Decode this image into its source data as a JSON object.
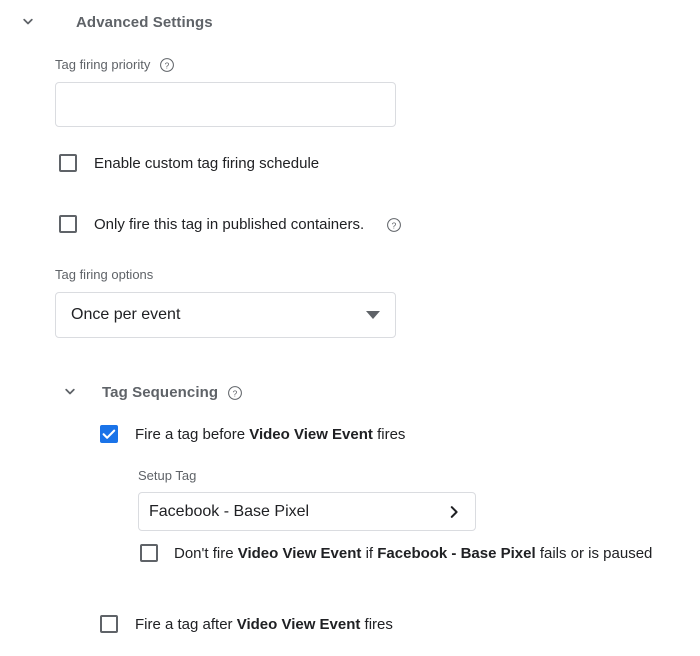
{
  "colors": {
    "accent": "#1a73e8",
    "label_gray": "#5f6368",
    "text_dark": "#202124",
    "border": "#dadce0",
    "background": "#ffffff"
  },
  "advanced_settings": {
    "title": "Advanced Settings",
    "expanded": true,
    "chevron_icon": "chevron-down-icon",
    "tag_firing_priority": {
      "label": "Tag firing priority",
      "help_icon": "help-circle-icon",
      "value": "",
      "placeholder": ""
    },
    "checkboxes": [
      {
        "label": "Enable custom tag firing schedule",
        "checked": false,
        "has_help": false
      },
      {
        "label": "Only fire this tag in published containers.",
        "checked": false,
        "has_help": true,
        "help_icon": "help-circle-icon"
      }
    ],
    "tag_firing_options": {
      "label": "Tag firing options",
      "selected": "Once per event",
      "dropdown_icon": "triangle-down-icon"
    }
  },
  "tag_sequencing": {
    "title": "Tag Sequencing",
    "expanded": true,
    "chevron_icon": "chevron-down-icon",
    "help_icon": "help-circle-icon",
    "fire_before": {
      "checked": true,
      "text_prefix": "Fire a tag before ",
      "tag_name": "Video View Event",
      "text_suffix": " fires"
    },
    "setup_tag": {
      "label": "Setup Tag",
      "value": "Facebook - Base Pixel",
      "chevron_icon": "chevron-right-icon"
    },
    "dont_fire": {
      "checked": false,
      "part1": "Don't fire ",
      "bold1": "Video View Event",
      "part2": " if ",
      "bold2": "Facebook - Base Pixel",
      "part3": " fails or is paused"
    },
    "fire_after": {
      "checked": false,
      "text_prefix": "Fire a tag after ",
      "tag_name": "Video View Event",
      "text_suffix": " fires"
    }
  }
}
